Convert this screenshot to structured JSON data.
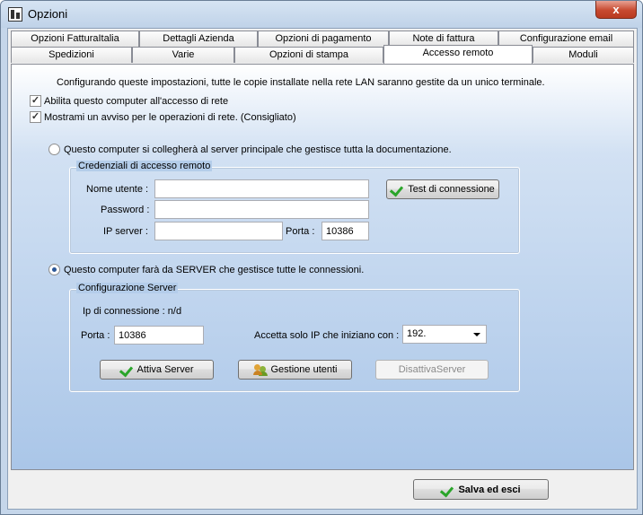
{
  "window": {
    "title": "Opzioni",
    "close_label": "x"
  },
  "tabs": {
    "row1": [
      "Opzioni FatturaItalia",
      "Dettagli Azienda",
      "Opzioni di pagamento",
      "Note di fattura",
      "Configurazione email"
    ],
    "row2": [
      "Spedizioni",
      "Varie",
      "Opzioni di stampa",
      "Accesso remoto",
      "Moduli"
    ],
    "active": "Accesso remoto"
  },
  "panel": {
    "intro": "Configurando queste impostazioni, tutte le copie installate nella rete LAN saranno gestite da un unico terminale.",
    "enable_network": {
      "label": "Abilita questo computer all'accesso di rete",
      "checked": true
    },
    "show_warning": {
      "label": "Mostrami un avviso per le operazioni di rete. (Consigliato)",
      "checked": true
    },
    "client_mode": {
      "label": "Questo computer si collegherà al server principale che gestisce tutta la documentazione.",
      "selected": false
    },
    "credentials": {
      "legend": "Credenziali di accesso remoto",
      "username_label": "Nome utente :",
      "username_value": "",
      "password_label": "Password :",
      "password_value": "",
      "ip_label": "IP server :",
      "ip_value": "",
      "port_label": "Porta :",
      "port_value": "10386",
      "test_button": "Test di connessione"
    },
    "server_mode": {
      "label": "Questo computer farà da SERVER che gestisce tutte le connessioni.",
      "selected": true
    },
    "server_config": {
      "legend": "Configurazione Server",
      "ip_connection": "Ip di connessione : n/d",
      "port_label": "Porta :",
      "port_value": "10386",
      "accept_label": "Accetta solo IP che iniziano con :",
      "accept_value": "192.",
      "activate_button": "Attiva Server",
      "users_button": "Gestione utenti",
      "deactivate_button": "DisattivaServer"
    }
  },
  "footer": {
    "save_button": "Salva ed esci"
  },
  "colors": {
    "accent": "#2aa52a",
    "panel_gradient_end": "#aac6e8",
    "close": "#c74a30"
  }
}
